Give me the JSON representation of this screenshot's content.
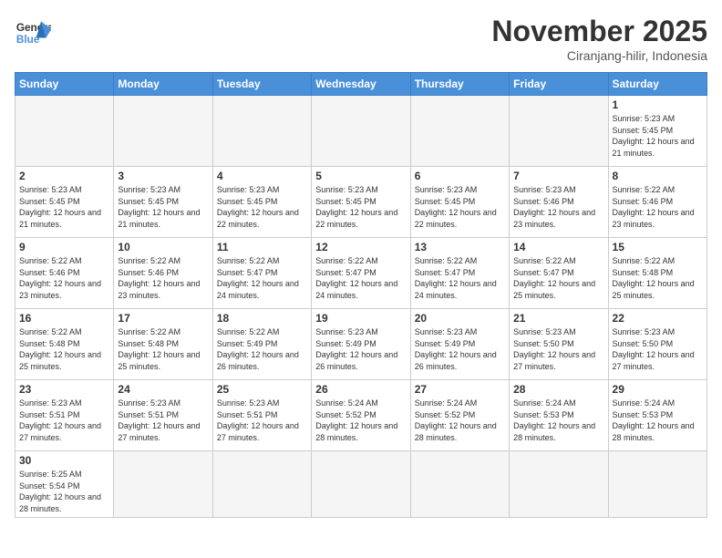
{
  "header": {
    "logo_general": "General",
    "logo_blue": "Blue",
    "month_title": "November 2025",
    "location": "Ciranjang-hilir, Indonesia"
  },
  "weekdays": [
    "Sunday",
    "Monday",
    "Tuesday",
    "Wednesday",
    "Thursday",
    "Friday",
    "Saturday"
  ],
  "weeks": [
    [
      {
        "day": "",
        "empty": true
      },
      {
        "day": "",
        "empty": true
      },
      {
        "day": "",
        "empty": true
      },
      {
        "day": "",
        "empty": true
      },
      {
        "day": "",
        "empty": true
      },
      {
        "day": "",
        "empty": true
      },
      {
        "day": "1",
        "sunrise": "5:23 AM",
        "sunset": "5:45 PM",
        "daylight": "12 hours and 21 minutes."
      }
    ],
    [
      {
        "day": "2",
        "sunrise": "5:23 AM",
        "sunset": "5:45 PM",
        "daylight": "12 hours and 21 minutes."
      },
      {
        "day": "3",
        "sunrise": "5:23 AM",
        "sunset": "5:45 PM",
        "daylight": "12 hours and 21 minutes."
      },
      {
        "day": "4",
        "sunrise": "5:23 AM",
        "sunset": "5:45 PM",
        "daylight": "12 hours and 22 minutes."
      },
      {
        "day": "5",
        "sunrise": "5:23 AM",
        "sunset": "5:45 PM",
        "daylight": "12 hours and 22 minutes."
      },
      {
        "day": "6",
        "sunrise": "5:23 AM",
        "sunset": "5:45 PM",
        "daylight": "12 hours and 22 minutes."
      },
      {
        "day": "7",
        "sunrise": "5:23 AM",
        "sunset": "5:46 PM",
        "daylight": "12 hours and 23 minutes."
      },
      {
        "day": "8",
        "sunrise": "5:22 AM",
        "sunset": "5:46 PM",
        "daylight": "12 hours and 23 minutes."
      }
    ],
    [
      {
        "day": "9",
        "sunrise": "5:22 AM",
        "sunset": "5:46 PM",
        "daylight": "12 hours and 23 minutes."
      },
      {
        "day": "10",
        "sunrise": "5:22 AM",
        "sunset": "5:46 PM",
        "daylight": "12 hours and 23 minutes."
      },
      {
        "day": "11",
        "sunrise": "5:22 AM",
        "sunset": "5:47 PM",
        "daylight": "12 hours and 24 minutes."
      },
      {
        "day": "12",
        "sunrise": "5:22 AM",
        "sunset": "5:47 PM",
        "daylight": "12 hours and 24 minutes."
      },
      {
        "day": "13",
        "sunrise": "5:22 AM",
        "sunset": "5:47 PM",
        "daylight": "12 hours and 24 minutes."
      },
      {
        "day": "14",
        "sunrise": "5:22 AM",
        "sunset": "5:47 PM",
        "daylight": "12 hours and 25 minutes."
      },
      {
        "day": "15",
        "sunrise": "5:22 AM",
        "sunset": "5:48 PM",
        "daylight": "12 hours and 25 minutes."
      }
    ],
    [
      {
        "day": "16",
        "sunrise": "5:22 AM",
        "sunset": "5:48 PM",
        "daylight": "12 hours and 25 minutes."
      },
      {
        "day": "17",
        "sunrise": "5:22 AM",
        "sunset": "5:48 PM",
        "daylight": "12 hours and 25 minutes."
      },
      {
        "day": "18",
        "sunrise": "5:22 AM",
        "sunset": "5:49 PM",
        "daylight": "12 hours and 26 minutes."
      },
      {
        "day": "19",
        "sunrise": "5:23 AM",
        "sunset": "5:49 PM",
        "daylight": "12 hours and 26 minutes."
      },
      {
        "day": "20",
        "sunrise": "5:23 AM",
        "sunset": "5:49 PM",
        "daylight": "12 hours and 26 minutes."
      },
      {
        "day": "21",
        "sunrise": "5:23 AM",
        "sunset": "5:50 PM",
        "daylight": "12 hours and 27 minutes."
      },
      {
        "day": "22",
        "sunrise": "5:23 AM",
        "sunset": "5:50 PM",
        "daylight": "12 hours and 27 minutes."
      }
    ],
    [
      {
        "day": "23",
        "sunrise": "5:23 AM",
        "sunset": "5:51 PM",
        "daylight": "12 hours and 27 minutes."
      },
      {
        "day": "24",
        "sunrise": "5:23 AM",
        "sunset": "5:51 PM",
        "daylight": "12 hours and 27 minutes."
      },
      {
        "day": "25",
        "sunrise": "5:23 AM",
        "sunset": "5:51 PM",
        "daylight": "12 hours and 27 minutes."
      },
      {
        "day": "26",
        "sunrise": "5:24 AM",
        "sunset": "5:52 PM",
        "daylight": "12 hours and 28 minutes."
      },
      {
        "day": "27",
        "sunrise": "5:24 AM",
        "sunset": "5:52 PM",
        "daylight": "12 hours and 28 minutes."
      },
      {
        "day": "28",
        "sunrise": "5:24 AM",
        "sunset": "5:53 PM",
        "daylight": "12 hours and 28 minutes."
      },
      {
        "day": "29",
        "sunrise": "5:24 AM",
        "sunset": "5:53 PM",
        "daylight": "12 hours and 28 minutes."
      }
    ],
    [
      {
        "day": "30",
        "sunrise": "5:25 AM",
        "sunset": "5:54 PM",
        "daylight": "12 hours and 28 minutes."
      },
      {
        "day": "",
        "empty": true
      },
      {
        "day": "",
        "empty": true
      },
      {
        "day": "",
        "empty": true
      },
      {
        "day": "",
        "empty": true
      },
      {
        "day": "",
        "empty": true
      },
      {
        "day": "",
        "empty": true
      }
    ]
  ]
}
